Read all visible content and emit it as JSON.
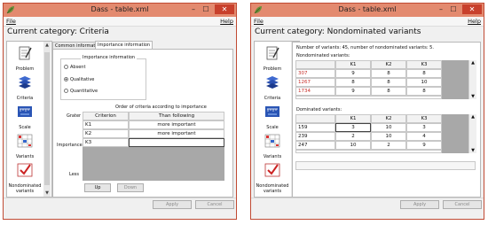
{
  "app": {
    "title": "Dass - table.xml",
    "menu_file": "File",
    "menu_help": "Help",
    "min_glyph": "–",
    "max_glyph": "☐",
    "close_glyph": "✕"
  },
  "nav": {
    "items": [
      {
        "label": "Problem"
      },
      {
        "label": "Criteria"
      },
      {
        "label": "Scale"
      },
      {
        "label": "Variants"
      },
      {
        "label": "Nondominated variants"
      }
    ]
  },
  "left": {
    "category": "Current category: Criteria",
    "tabs": [
      "Common information",
      "Importance information"
    ],
    "importance_caption": "Importance information",
    "radios": [
      "Absent",
      "Qualitative",
      "Quantitative"
    ],
    "selected_radio": "Qualitative",
    "order_caption": "Order of criteria according to importance",
    "grater_label": "Grater",
    "importance_label": "Importance",
    "less_label": "Less",
    "table_headers": [
      "Criterion",
      "Than following"
    ],
    "rows": [
      {
        "criterion": "K1",
        "than": "more important"
      },
      {
        "criterion": "K2",
        "than": "more important"
      },
      {
        "criterion": "K3",
        "than": ""
      }
    ],
    "up_label": "Up",
    "down_label": "Down"
  },
  "right": {
    "category": "Current category: Nondominated variants",
    "info": "Number of variants: 45, number of nondominated variants: 5.",
    "nondom_caption": "Nondominated variants:",
    "nondom_headers": [
      "K1",
      "K2",
      "K3"
    ],
    "nondom_rows": [
      {
        "id": "307",
        "k1": "9",
        "k2": "8",
        "k3": "8"
      },
      {
        "id": "1267",
        "k1": "8",
        "k2": "8",
        "k3": "10"
      },
      {
        "id": "1734",
        "k1": "9",
        "k2": "8",
        "k3": "8"
      }
    ],
    "dom_caption": "Dominated variants:",
    "dom_headers": [
      "K1",
      "K2",
      "K3"
    ],
    "dom_rows": [
      {
        "id": "159",
        "k1": "3",
        "k2": "10",
        "k3": "3"
      },
      {
        "id": "239",
        "k1": "2",
        "k2": "10",
        "k3": "4"
      },
      {
        "id": "247",
        "k1": "10",
        "k2": "2",
        "k3": "9"
      }
    ]
  },
  "footer": {
    "apply": "Apply",
    "cancel": "Cancel"
  }
}
